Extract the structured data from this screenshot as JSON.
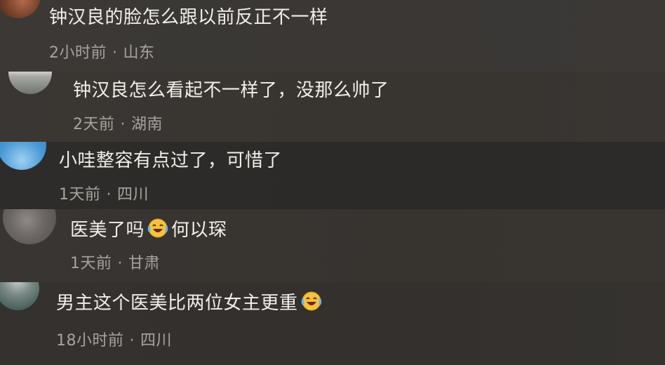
{
  "comments": [
    {
      "text": "钟汉良的脸怎么跟以前反正不一样",
      "time": "2小时前",
      "location": "山东"
    },
    {
      "text": "钟汉良怎么看起不一样了，没那么帅了",
      "time": "2天前",
      "location": "湖南"
    },
    {
      "text": "小哇整容有点过了，可惜了",
      "time": "1天前",
      "location": "四川"
    },
    {
      "text_before": "医美了吗",
      "text_after": "何以琛",
      "emoji": "laughing-tears-emoji",
      "time": "1天前",
      "location": "甘肃"
    },
    {
      "text_before": "男主这个医美比两位女主更重",
      "emoji": "laughing-tears-emoji",
      "time": "18小时前",
      "location": "四川"
    }
  ],
  "separator": "·"
}
